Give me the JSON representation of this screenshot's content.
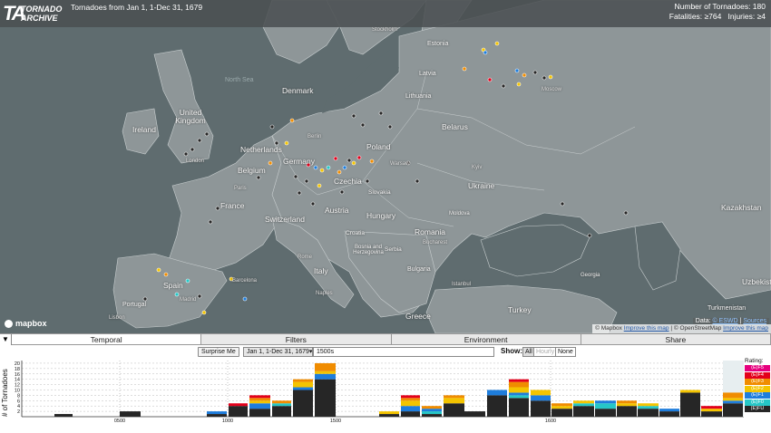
{
  "header": {
    "logo_ta": "TA",
    "logo_line1": "TORNADO",
    "logo_line2": "ARCHIVE",
    "title": "Tornadoes from Jan 1, 1-Dec 31, 1679",
    "tornado_count": "Number of Tornadoes: 180",
    "fatalities": "Fatalities: ≥764",
    "injuries": "Injuries: ≥4"
  },
  "map": {
    "countries": [
      {
        "name": "Ireland",
        "class": "country"
      },
      {
        "name": "United Kingdom",
        "class": "country"
      },
      {
        "name": "Denmark",
        "class": "country"
      },
      {
        "name": "Netherlands",
        "class": "country"
      },
      {
        "name": "Belgium",
        "class": "country"
      },
      {
        "name": "Germany",
        "class": "country"
      },
      {
        "name": "France",
        "class": "country"
      },
      {
        "name": "Switzerland",
        "class": "country"
      },
      {
        "name": "Austria",
        "class": "country"
      },
      {
        "name": "Czechia",
        "class": "country"
      },
      {
        "name": "Poland",
        "class": "country"
      },
      {
        "name": "Slovakia",
        "class": "country"
      },
      {
        "name": "Hungary",
        "class": "country"
      },
      {
        "name": "Lithuania",
        "class": "country"
      },
      {
        "name": "Latvia",
        "class": "country"
      },
      {
        "name": "Estonia",
        "class": "country"
      },
      {
        "name": "Belarus",
        "class": "country"
      },
      {
        "name": "Ukraine",
        "class": "country"
      },
      {
        "name": "Moldova",
        "class": "country"
      },
      {
        "name": "Romania",
        "class": "country"
      },
      {
        "name": "Bulgaria",
        "class": "country"
      },
      {
        "name": "Serbia",
        "class": "country"
      },
      {
        "name": "Croatia",
        "class": "country"
      },
      {
        "name": "Bosnia and Herzegovina",
        "class": "country"
      },
      {
        "name": "Italy",
        "class": "country"
      },
      {
        "name": "Spain",
        "class": "country"
      },
      {
        "name": "Portugal",
        "class": "country"
      },
      {
        "name": "Greece",
        "class": "country"
      },
      {
        "name": "Turkey",
        "class": "country"
      },
      {
        "name": "Georgia",
        "class": "country"
      },
      {
        "name": "Kazakhstan",
        "class": "country"
      },
      {
        "name": "Turkmenistan",
        "class": "country"
      },
      {
        "name": "Uzbekistan",
        "class": "country"
      },
      {
        "name": "North Sea",
        "class": "sea"
      },
      {
        "name": "Moscow",
        "class": "city"
      },
      {
        "name": "London",
        "class": "city"
      },
      {
        "name": "Paris",
        "class": "city"
      },
      {
        "name": "Berlin",
        "class": "city"
      },
      {
        "name": "Madrid",
        "class": "city"
      },
      {
        "name": "Istanbul",
        "class": "city"
      },
      {
        "name": "Barcelona",
        "class": "city"
      },
      {
        "name": "Stockholm",
        "class": "city"
      },
      {
        "name": "Lisbon",
        "class": "city"
      },
      {
        "name": "Bucharest",
        "class": "city"
      },
      {
        "name": "Naples",
        "class": "city"
      },
      {
        "name": "Warsaw",
        "class": "city"
      },
      {
        "name": "Kyiv",
        "class": "city"
      },
      {
        "name": "Rome",
        "class": "city"
      }
    ],
    "mapbox_logo": "mapbox",
    "attribution": {
      "data_label": "Data:",
      "source_1": "© ESWD",
      "source_2": "Sources",
      "mapbox": "© Mapbox",
      "improve": "Improve this map",
      "osm": "© OpenStreetMap",
      "improve2": "Improve this map"
    },
    "colors": {
      "water": "#5f6c6f",
      "land": "#8e9698",
      "border": "#c9cfd0"
    }
  },
  "tabs": {
    "collapse_icon": "▼",
    "items": [
      {
        "label": "Temporal",
        "active": true
      },
      {
        "label": "Filters",
        "active": false
      },
      {
        "label": "Environment",
        "active": false
      },
      {
        "label": "Share",
        "active": false
      }
    ]
  },
  "controls": {
    "surprise_label": "Surprise Me",
    "period_selected": "Jan 1, 1-Dec 31, 1679",
    "period_input": "1500s",
    "show_label": "Show:",
    "show_all": "All",
    "show_hourly": "Hourly",
    "show_none": "None"
  },
  "chart_data": {
    "type": "bar",
    "stacked": true,
    "ylabel": "# of Tornadoes",
    "y_ticks": [
      2,
      4,
      6,
      8,
      10,
      12,
      14,
      16,
      18,
      20
    ],
    "ylim": [
      0,
      21
    ],
    "x_ticks": [
      "0500",
      "1000",
      "1500",
      "1600"
    ],
    "legend_title": "Rating:",
    "legend": [
      {
        "name": "(E)F5",
        "color": "#e6007e"
      },
      {
        "name": "(E)F4",
        "color": "#e3001b"
      },
      {
        "name": "(E)F3",
        "color": "#f08c00"
      },
      {
        "name": "(E)F2",
        "color": "#f4c400"
      },
      {
        "name": "(E)F1",
        "color": "#1e7ddc"
      },
      {
        "name": "(E)F0",
        "color": "#26c7c7"
      },
      {
        "name": "(E)FU",
        "color": "#262626"
      }
    ],
    "bars": [
      {
        "x0": 60,
        "x1": 80,
        "unk": 1
      },
      {
        "x0": 132,
        "x1": 155,
        "unk": 2
      },
      {
        "x0": 228,
        "x1": 250,
        "unk": 1,
        "f1": 1
      },
      {
        "x0": 252,
        "x1": 273,
        "unk": 4,
        "f4": 1
      },
      {
        "x0": 275,
        "x1": 298,
        "unk": 3,
        "f1": 2,
        "f2": 1,
        "f3": 1,
        "f4": 1
      },
      {
        "x0": 300,
        "x1": 321,
        "unk": 4,
        "f0": 1,
        "f3": 1
      },
      {
        "x0": 323,
        "x1": 345,
        "unk": 10,
        "f1": 1,
        "f2": 2,
        "f3": 1
      },
      {
        "x0": 347,
        "x1": 370,
        "unk": 14,
        "f1": 2,
        "f2": 1,
        "f3": 3
      },
      {
        "x0": 418,
        "x1": 440,
        "unk": 1,
        "f2": 1
      },
      {
        "x0": 442,
        "x1": 463,
        "unk": 2,
        "f1": 2,
        "f2": 2,
        "f3": 1,
        "f4": 1
      },
      {
        "x0": 465,
        "x1": 487,
        "unk": 1,
        "f0": 1,
        "f1": 1,
        "f3": 1
      },
      {
        "x0": 489,
        "x1": 512,
        "unk": 5,
        "f2": 2,
        "f3": 1
      },
      {
        "x0": 512,
        "x1": 535,
        "unk": 2
      },
      {
        "x0": 537,
        "x1": 559,
        "unk": 8,
        "f1": 2
      },
      {
        "x0": 561,
        "x1": 583,
        "unk": 7,
        "f0": 1,
        "f1": 1,
        "f2": 2,
        "f3": 2,
        "f4": 1
      },
      {
        "x0": 585,
        "x1": 607,
        "unk": 6,
        "f1": 2,
        "f2": 2
      },
      {
        "x0": 608,
        "x1": 631,
        "unk": 3,
        "f2": 1,
        "f3": 1
      },
      {
        "x0": 632,
        "x1": 655,
        "unk": 4,
        "f0": 1,
        "f2": 1
      },
      {
        "x0": 656,
        "x1": 679,
        "unk": 3,
        "f0": 2,
        "f1": 1
      },
      {
        "x0": 680,
        "x1": 702,
        "unk": 4,
        "f2": 1,
        "f3": 1
      },
      {
        "x0": 703,
        "x1": 726,
        "unk": 3,
        "f0": 1,
        "f2": 1
      },
      {
        "x0": 727,
        "x1": 749,
        "unk": 2,
        "f1": 1
      },
      {
        "x0": 750,
        "x1": 772,
        "unk": 9,
        "f2": 1
      },
      {
        "x0": 773,
        "x1": 796,
        "unk": 2,
        "f2": 1,
        "f4": 1
      },
      {
        "x0": 797,
        "x1": 819,
        "unk": 5,
        "f1": 1,
        "f2": 1,
        "f3": 2
      }
    ]
  }
}
